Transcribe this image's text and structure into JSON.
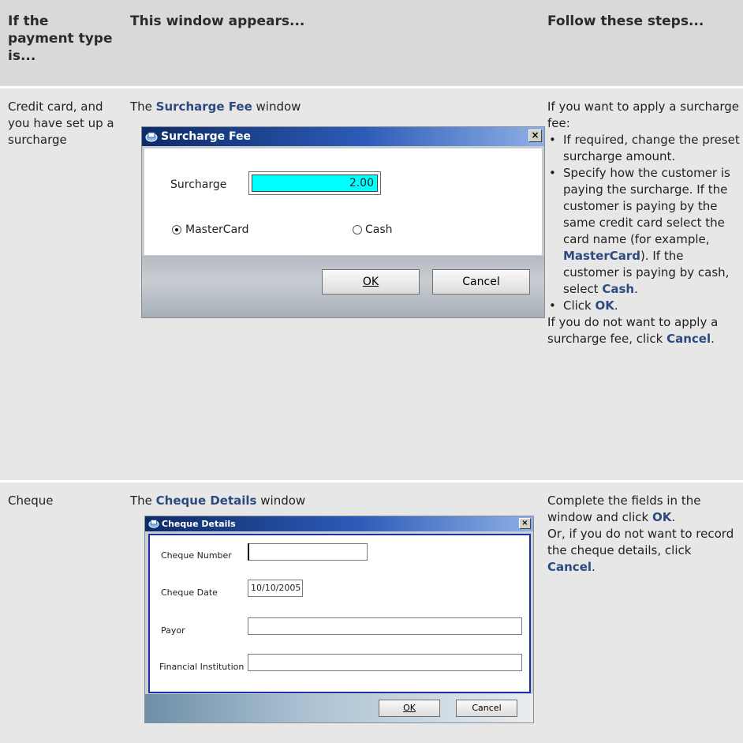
{
  "header": {
    "col1": "If the payment type is...",
    "col2": "This window appears...",
    "col3": "Follow these steps..."
  },
  "row1": {
    "payment_type": "Credit card, and you have set up a surcharge",
    "window_intro_pre": "The ",
    "window_name": "Surcharge Fee",
    "window_intro_post": " window",
    "dialog": {
      "title": "Surcharge Fee",
      "close": "×",
      "surcharge_label": "Surcharge",
      "surcharge_value": "2.00",
      "option1": "MasterCard",
      "option2": "Cash",
      "option1_selected": true,
      "ok_label": "OK",
      "cancel_label": "Cancel"
    },
    "steps_intro": "If you want to apply a surcharge fee:",
    "bullet1": "If required, change the preset surcharge amount.",
    "bullet2_a": "Specify how the customer is paying the surcharge. If the customer is paying by the same credit card select the card name (for example, ",
    "bullet2_b": "MasterCard",
    "bullet2_c": "). If the customer is paying by cash, select ",
    "bullet2_d": "Cash",
    "bullet2_e": ".",
    "bullet3_a": "Click ",
    "bullet3_b": "OK",
    "bullet3_c": ".",
    "outro_a": "If you do not want to apply a surcharge fee, click ",
    "outro_b": "Cancel",
    "outro_c": "."
  },
  "row2": {
    "payment_type": "Cheque",
    "window_intro_pre": "The ",
    "window_name": "Cheque Details",
    "window_intro_post": " window",
    "dialog": {
      "title": "Cheque Details",
      "close": "×",
      "cheque_number_label": "Cheque Number",
      "cheque_number_value": "",
      "cheque_date_label": "Cheque Date",
      "cheque_date_value": "10/10/2005",
      "payor_label": "Payor",
      "payor_value": "",
      "institution_label": "Financial Institution",
      "institution_value": "",
      "ok_label": "OK",
      "cancel_label": "Cancel"
    },
    "step1_a": "Complete the fields in the window and click ",
    "step1_b": "OK",
    "step1_c": ".",
    "step2_a": "Or, if you do not want to record the cheque details, click ",
    "step2_b": "Cancel",
    "step2_c": "."
  },
  "colors": {
    "highlight_text": "#2d4a80",
    "header_bg": "#d9d9d9",
    "row_bg": "#e7e7e7",
    "surcharge_field": "#00ffff"
  }
}
